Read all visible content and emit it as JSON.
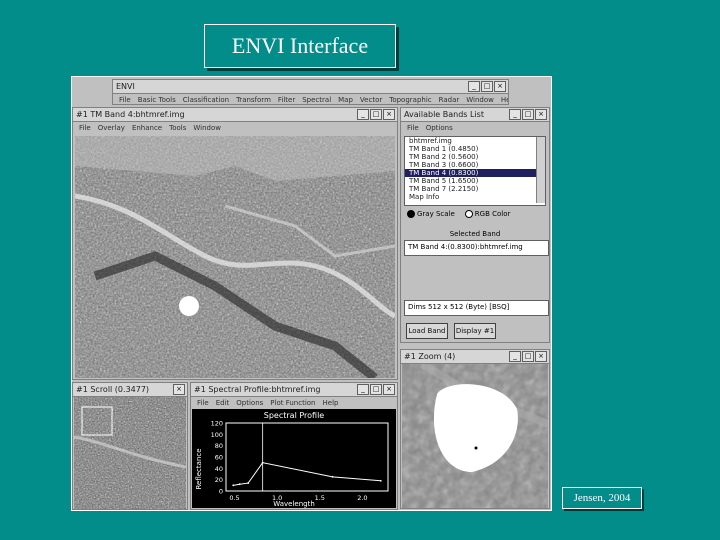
{
  "slide": {
    "title": "ENVI Interface",
    "credit": "Jensen, 2004"
  },
  "main_window": {
    "title": "ENVI",
    "menu": [
      "File",
      "Basic Tools",
      "Classification",
      "Transform",
      "Filter",
      "Spectral",
      "Map",
      "Vector",
      "Topographic",
      "Radar",
      "Window",
      "Help"
    ]
  },
  "image_window": {
    "title": "#1 TM Band 4:bhtmref.img",
    "menu": [
      "File",
      "Overlay",
      "Enhance",
      "Tools",
      "Window"
    ]
  },
  "bands_list": {
    "title": "Available Bands List",
    "menu": [
      "File",
      "Options"
    ],
    "items": [
      "bhtmref.img",
      "TM Band 1 (0.4850)",
      "TM Band 2 (0.5600)",
      "TM Band 3 (0.6600)",
      "TM Band 4 (0.8300)",
      "TM Band 5 (1.6500)",
      "TM Band 7 (2.2150)",
      "Map Info"
    ],
    "selected_index": 4,
    "radio_gray": "Gray Scale",
    "radio_rgb": "RGB Color",
    "selected_band_label": "Selected Band",
    "selected_band_value": "TM Band 4:(0.8300):bhtmref.img",
    "dims": "Dims 512 x 512 (Byte) [BSQ]",
    "load_button": "Load Band",
    "display_button": "Display #1"
  },
  "scroll_window": {
    "title": "#1 Scroll (0.3477)"
  },
  "zoom_window": {
    "title": "#1 Zoom (4)"
  },
  "profile_window": {
    "title": "#1 Spectral Profile:bhtmref.img",
    "menu": [
      "File",
      "Edit",
      "Options",
      "Plot Function",
      "Help"
    ]
  },
  "chart_data": {
    "type": "line",
    "title": "Spectral Profile",
    "xlabel": "Wavelength",
    "ylabel": "Reflectance",
    "x_ticks": [
      "0.5",
      "1.0",
      "1.5",
      "2.0"
    ],
    "y_ticks": [
      "0",
      "20",
      "40",
      "60",
      "80",
      "100",
      "120"
    ],
    "xlim": [
      0.4,
      2.3
    ],
    "ylim": [
      0,
      120
    ],
    "x": [
      0.485,
      0.56,
      0.66,
      0.83,
      1.65,
      2.215
    ],
    "values": [
      10,
      12,
      14,
      50,
      25,
      18
    ],
    "cursor_x": 0.83,
    "line_color": "#ffffff",
    "background": "#000000"
  }
}
